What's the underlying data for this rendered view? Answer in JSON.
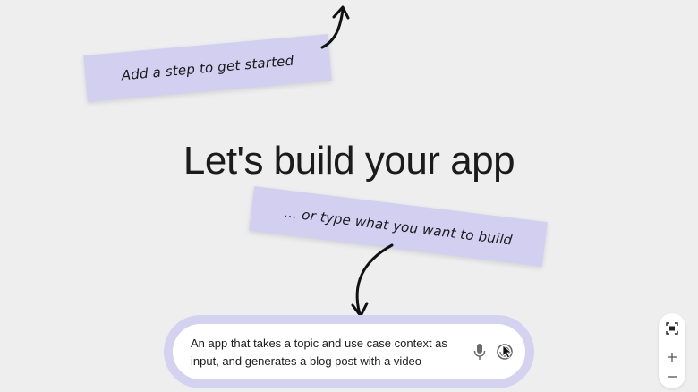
{
  "canvas": {
    "headline": "Let's build your app",
    "notes": [
      {
        "text": "Add a step to get started"
      },
      {
        "text": "... or type what you want to build"
      }
    ]
  },
  "prompt": {
    "text": "An app that takes a topic and use case context as\ninput, and generates a blog post with a video",
    "mic_icon": "microphone-icon",
    "submit_icon": "submit-icon"
  },
  "zoom_controls": {
    "fit_icon": "fit-to-screen-icon",
    "zoom_in_icon": "plus-icon",
    "zoom_out_icon": "minus-icon"
  },
  "colors": {
    "background": "#eeeeee",
    "sticky_note": "#d2cff1",
    "prompt_ring": "#d5d2f1",
    "text": "#1b1b1b"
  }
}
